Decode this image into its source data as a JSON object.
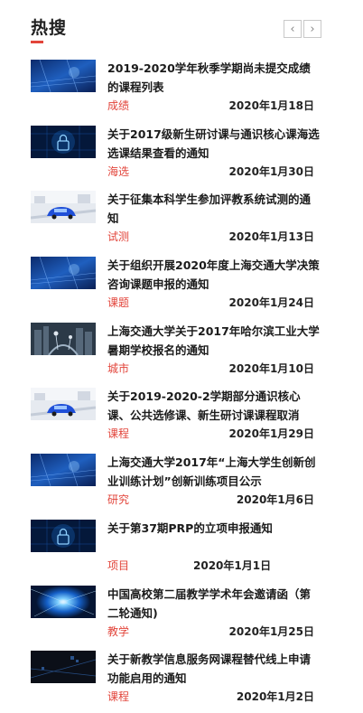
{
  "header": {
    "title": "热搜",
    "prev_icon": "chevron-left-icon",
    "next_icon": "chevron-right-icon",
    "accent_color": "#e2443a"
  },
  "items": [
    {
      "title": "2019-2020学年秋季学期尚未提交成绩的课程列表",
      "category": "成绩",
      "date": "2020年1月18日",
      "thumb": "blue-tech"
    },
    {
      "title": "关于2017级新生研讨课与通识核心课海选选课结果查看的通知",
      "category": "海选",
      "date": "2020年1月30日",
      "thumb": "lock"
    },
    {
      "title": "关于征集本科学生参加评教系统试测的通知",
      "category": "试测",
      "date": "2020年1月13日",
      "thumb": "car"
    },
    {
      "title": "关于组织开展2020年度上海交通大学决策咨询课题申报的通知",
      "category": "课题",
      "date": "2020年1月24日",
      "thumb": "blue-tech"
    },
    {
      "title": "上海交通大学关于2017年哈尔滨工业大学暑期学校报名的通知",
      "category": "城市",
      "date": "2020年1月10日",
      "thumb": "city"
    },
    {
      "title": "关于2019-2020-2学期部分通识核心课、公共选修课、新生研讨课课程取消的...",
      "category": "课程",
      "date": "2020年1月29日",
      "thumb": "car"
    },
    {
      "title": "上海交通大学2017年“上海大学生创新创业训练计划”创新训练项目公示",
      "category": "研究",
      "date": "2020年1月6日",
      "thumb": "blue-tech"
    },
    {
      "title": "关于第37期PRP的立项申报通知",
      "category": "项目",
      "date": "2020年1月1日",
      "thumb": "lock",
      "short": true
    },
    {
      "title": "中国高校第二届教学学术年会邀请函（第二轮通知)",
      "category": "教学",
      "date": "2020年1月25日",
      "thumb": "burst"
    },
    {
      "title": "关于新教学信息服务网课程替代线上申请功能启用的通知",
      "category": "课程",
      "date": "2020年1月2日",
      "thumb": "dark-tech"
    }
  ]
}
